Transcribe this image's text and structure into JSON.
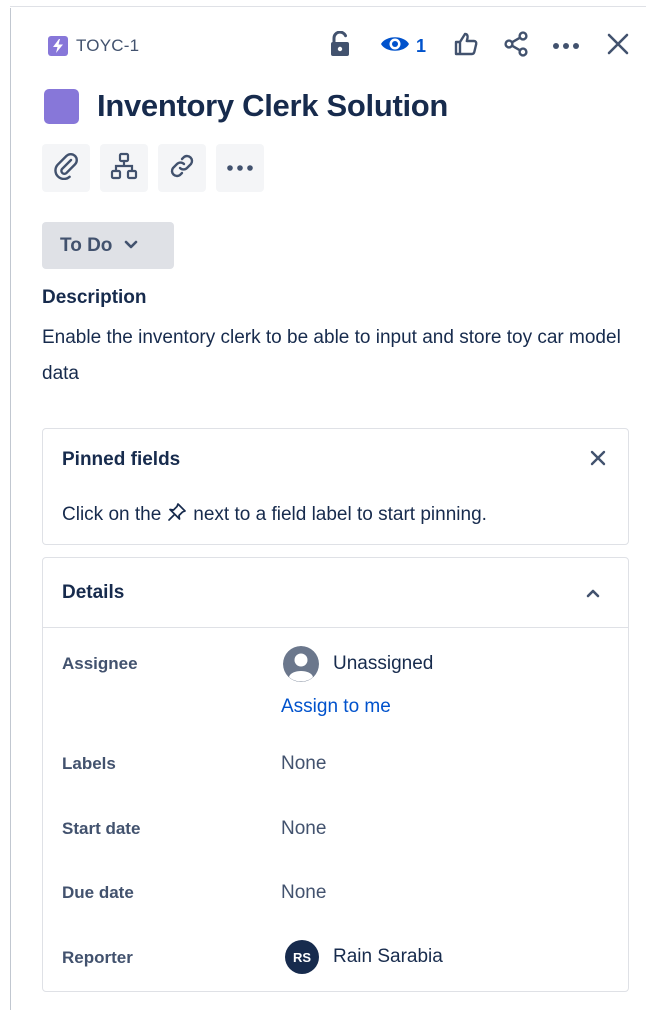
{
  "issue": {
    "key": "TOYC-1",
    "title": "Inventory Clerk Solution",
    "type_icon": "lightning-bolt-icon",
    "type_color": "#8777d9"
  },
  "header": {
    "watch_count": "1",
    "icons": [
      "unlock-icon",
      "eye-icon",
      "thumbs-up-icon",
      "share-icon",
      "more-icon",
      "close-icon"
    ],
    "accent": "#0052cc"
  },
  "toolbar": {
    "icons": [
      "paperclip-icon",
      "child-issues-icon",
      "link-icon",
      "more-icon"
    ]
  },
  "status": {
    "label": "To Do"
  },
  "description": {
    "heading": "Description",
    "body": "Enable the inventory clerk to be able to input and store toy car model data"
  },
  "pinned": {
    "title": "Pinned fields",
    "hint_before": "Click on the",
    "hint_after": "next to a field label to start pinning."
  },
  "details": {
    "title": "Details",
    "assignee": {
      "label": "Assignee",
      "value": "Unassigned",
      "action": "Assign to me"
    },
    "labels": {
      "label": "Labels",
      "value": "None"
    },
    "start_date": {
      "label": "Start date",
      "value": "None"
    },
    "due_date": {
      "label": "Due date",
      "value": "None"
    },
    "reporter": {
      "label": "Reporter",
      "initials": "RS",
      "name": "Rain Sarabia"
    }
  }
}
